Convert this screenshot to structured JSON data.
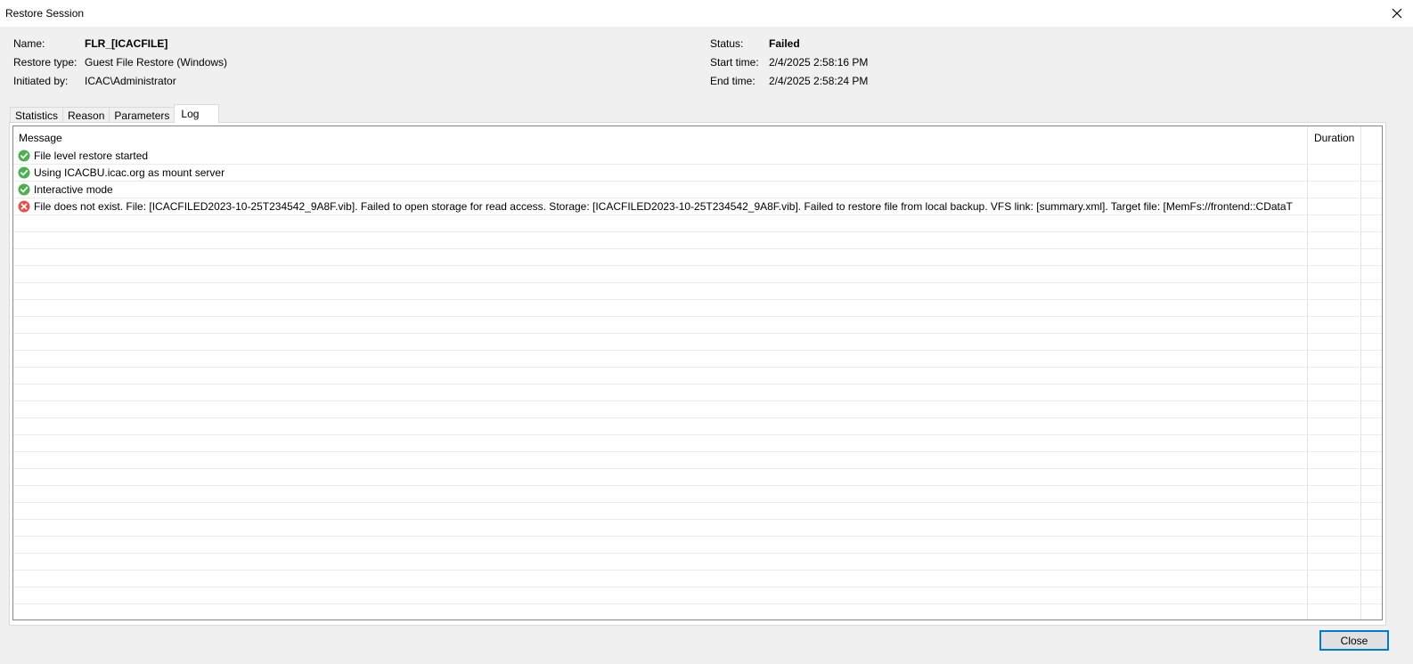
{
  "window": {
    "title": "Restore Session"
  },
  "info": {
    "name_label": "Name:",
    "name_value": "FLR_[ICACFILE]",
    "restore_type_label": "Restore type:",
    "restore_type_value": "Guest File Restore (Windows)",
    "initiated_by_label": "Initiated by:",
    "initiated_by_value": "ICAC\\Administrator",
    "status_label": "Status:",
    "status_value": "Failed",
    "start_time_label": "Start time:",
    "start_time_value": "2/4/2025 2:58:16 PM",
    "end_time_label": "End time:",
    "end_time_value": "2/4/2025 2:58:24 PM"
  },
  "tabs": [
    {
      "label": "Statistics"
    },
    {
      "label": "Reason"
    },
    {
      "label": "Parameters"
    },
    {
      "label": "Log",
      "active": true
    }
  ],
  "log": {
    "columns": {
      "message": "Message",
      "duration": "Duration"
    },
    "rows": [
      {
        "status": "success",
        "message": "File level restore started",
        "duration": ""
      },
      {
        "status": "success",
        "message": "Using ICACBU.icac.org as mount server",
        "duration": ""
      },
      {
        "status": "success",
        "message": "Interactive mode",
        "duration": ""
      },
      {
        "status": "error",
        "message": "File does not exist. File: [ICACFILED2023-10-25T234542_9A8F.vib]. Failed to open storage for read access. Storage: [ICACFILED2023-10-25T234542_9A8F.vib]. Failed to restore file from local backup. VFS link: [summary.xml]. Target file: [MemFs://frontend::CDataT",
        "duration": ""
      }
    ]
  },
  "footer": {
    "close_label": "Close"
  },
  "colors": {
    "success": "#4caf50",
    "error": "#e0524b",
    "accent": "#0078d7"
  },
  "icons": {
    "success": "check-circle-icon",
    "error": "error-circle-icon",
    "close": "close-icon"
  }
}
